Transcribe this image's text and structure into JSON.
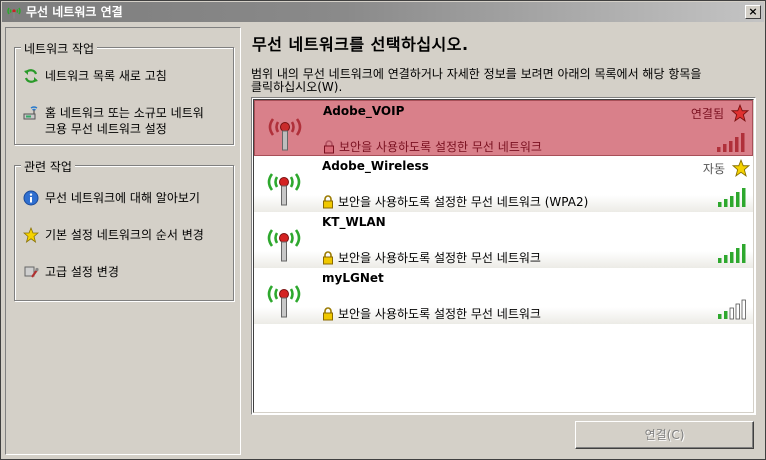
{
  "window": {
    "title": "무선 네트워크 연결",
    "close": "×"
  },
  "sidebar": {
    "network_tasks": {
      "title": "네트워크 작업",
      "items": [
        {
          "label": "네트워크 목록 새로 고침",
          "icon": "refresh-icon"
        },
        {
          "label_line1": "홈 네트워크 또는 소규모 네트워",
          "label_line2": "크용 무선 네트워크 설정",
          "icon": "wireless-setup-icon"
        }
      ]
    },
    "related_tasks": {
      "title": "관련 작업",
      "items": [
        {
          "label": "무선 네트워크에 대해 알아보기",
          "icon": "info-icon"
        },
        {
          "label": "기본 설정 네트워크의 순서 변경",
          "icon": "star-icon"
        },
        {
          "label": "고급 설정 변경",
          "icon": "settings-icon"
        }
      ]
    }
  },
  "main": {
    "heading": "무선 네트워크를 선택하십시오.",
    "description_line1": "범위 내의 무선 네트워크에 연결하거나 자세한 정보를 보려면 아래의 목록에서 해당 항목을",
    "description_line2": "클릭하십시오(W).",
    "networks": [
      {
        "name": "Adobe_VOIP",
        "status": "연결됨",
        "security": "보안을 사용하도록 설정한 무선 네트워크",
        "signal": 5,
        "selected": true,
        "star": "red"
      },
      {
        "name": "Adobe_Wireless",
        "status": "자동",
        "security": "보안을 사용하도록 설정한 무선 네트워크 (WPA2)",
        "signal": 5,
        "selected": false,
        "star": "yellow"
      },
      {
        "name": "KT_WLAN",
        "status": "",
        "security": "보안을 사용하도록 설정한 무선 네트워크",
        "signal": 5,
        "selected": false,
        "star": ""
      },
      {
        "name": "myLGNet",
        "status": "",
        "security": "보안을 사용하도록 설정한 무선 네트워크",
        "signal": 2,
        "selected": false,
        "star": ""
      }
    ],
    "connect_button": "연결(C)"
  },
  "colors": {
    "selected_row": "#d9808a",
    "signal_green": "#2ea82e",
    "signal_red": "#b0303a"
  }
}
